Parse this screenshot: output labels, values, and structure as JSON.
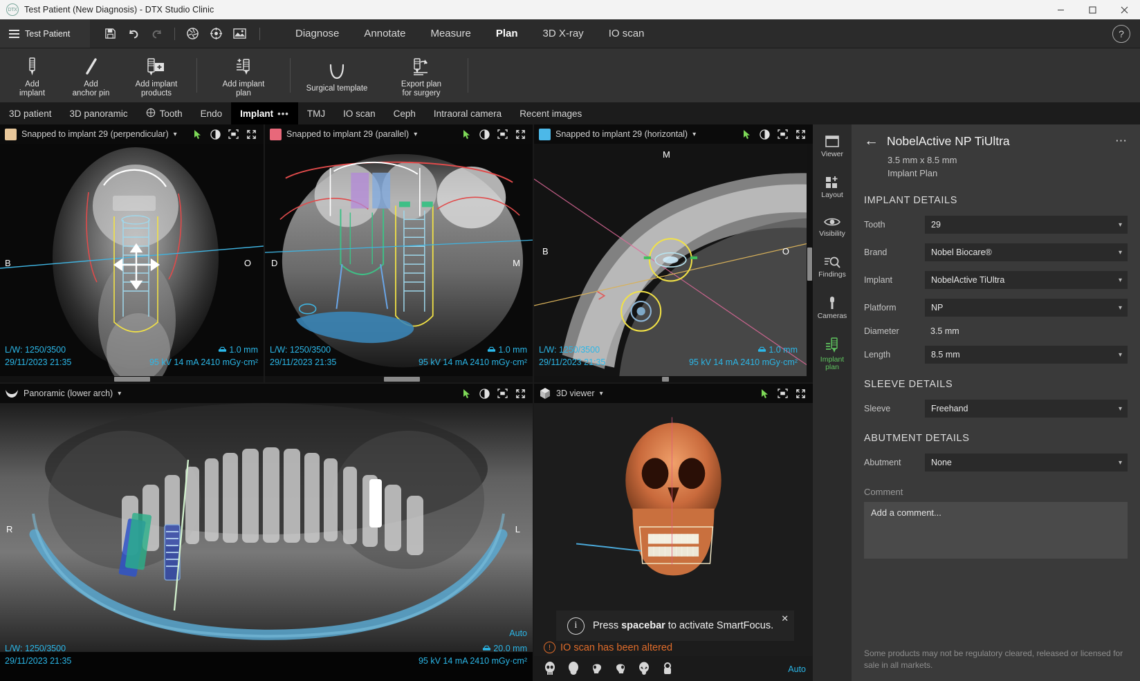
{
  "window": {
    "title": "Test Patient (New Diagnosis) - DTX Studio Clinic",
    "app_badge": "DTX",
    "minimize": "─",
    "maximize": "☐",
    "close": "✕"
  },
  "menubar": {
    "patient_name": "Test Patient",
    "icons": [
      "save-icon",
      "undo-icon",
      "redo-icon",
      "aperture-icon",
      "crosshair-icon",
      "image-icon"
    ],
    "items": [
      {
        "label": "Diagnose",
        "active": false
      },
      {
        "label": "Annotate",
        "active": false
      },
      {
        "label": "Measure",
        "active": false
      },
      {
        "label": "Plan",
        "active": true
      },
      {
        "label": "3D X-ray",
        "active": false
      },
      {
        "label": "IO scan",
        "active": false
      }
    ],
    "help": "?"
  },
  "ribbon": {
    "buttons": [
      {
        "label_line1": "Add",
        "label_line2": "implant",
        "icon": "implant-icon"
      },
      {
        "label_line1": "Add",
        "label_line2": "anchor pin",
        "icon": "anchor-pin-icon"
      },
      {
        "label_line1": "Add implant",
        "label_line2": "products",
        "icon": "implant-products-icon"
      },
      {
        "label_line1": "Add implant",
        "label_line2": "plan",
        "icon": "implant-plan-icon"
      },
      {
        "label_line1": "Surgical template",
        "label_line2": "",
        "icon": "surgical-template-icon"
      },
      {
        "label_line1": "Export plan",
        "label_line2": "for surgery",
        "icon": "export-plan-icon"
      }
    ]
  },
  "tabs": [
    {
      "label": "3D patient",
      "active": false,
      "icon": ""
    },
    {
      "label": "3D panoramic",
      "active": false,
      "icon": ""
    },
    {
      "label": "Tooth",
      "active": false,
      "icon": "tooth-icon"
    },
    {
      "label": "Endo",
      "active": false,
      "icon": ""
    },
    {
      "label": "Implant",
      "active": true,
      "icon": "",
      "overflow": "•••"
    },
    {
      "label": "TMJ",
      "active": false,
      "icon": ""
    },
    {
      "label": "IO scan",
      "active": false,
      "icon": ""
    },
    {
      "label": "Ceph",
      "active": false,
      "icon": ""
    },
    {
      "label": "Intraoral camera",
      "active": false,
      "icon": ""
    },
    {
      "label": "Recent images",
      "active": false,
      "icon": ""
    }
  ],
  "viewports": {
    "perpendicular": {
      "title": "Snapped to implant 29 (perpendicular)",
      "swatch_color": "#e8c79a",
      "lw": "L/W: 1250/3500",
      "datetime": "29/11/2023 21:35",
      "thickness": "1.0 mm",
      "dose": "95 kV  14 mA  2410 mGy·cm²",
      "marker_left": "B",
      "marker_right": "O"
    },
    "parallel": {
      "title": "Snapped to implant 29 (parallel)",
      "swatch_color": "#e8687a",
      "lw": "L/W: 1250/3500",
      "datetime": "29/11/2023 21:35",
      "thickness": "1.0 mm",
      "dose": "95 kV  14 mA  2410 mGy·cm²",
      "marker_left": "D",
      "marker_right": "M"
    },
    "horizontal": {
      "title": "Snapped to implant 29 (horizontal)",
      "swatch_color": "#4cb8e8",
      "lw": "L/W: 1250/3500",
      "datetime": "29/11/2023 21:35",
      "thickness": "1.0 mm",
      "dose": "95 kV  14 mA  2410 mGy·cm²",
      "marker_left": "B",
      "marker_right": "O",
      "marker_top": "M"
    },
    "panoramic": {
      "title": "Panoramic (lower arch)",
      "lw": "L/W: 1250/3500",
      "datetime": "29/11/2023 21:35",
      "thickness": "20.0 mm",
      "dose": "95 kV  14 mA  2410 mGy·cm²",
      "auto": "Auto",
      "marker_left": "R",
      "marker_right": "L"
    },
    "viewer3d": {
      "title": "3D viewer",
      "auto": "Auto",
      "toast": {
        "text_before": "Press ",
        "text_bold": "spacebar",
        "text_after": " to activate SmartFocus.",
        "close": "✕"
      },
      "warning": "IO scan has been altered"
    }
  },
  "rail": [
    {
      "label": "Viewer",
      "icon": "viewer-icon",
      "active": false
    },
    {
      "label": "Layout",
      "icon": "layout-icon",
      "active": false
    },
    {
      "label": "Visibility",
      "icon": "eye-icon",
      "active": false
    },
    {
      "label": "Findings",
      "icon": "findings-icon",
      "active": false
    },
    {
      "label": "Cameras",
      "icon": "camera-icon",
      "active": false
    },
    {
      "label": "Implant\nplan",
      "icon": "implant-plan-icon",
      "active": true
    }
  ],
  "panel": {
    "title": "NobelActive NP TiUltra",
    "subtitle_size": "3.5 mm x 8.5 mm",
    "subtitle_type": "Implant Plan",
    "back": "←",
    "kebab": "⋯",
    "sections": {
      "implant_details": {
        "heading": "IMPLANT DETAILS",
        "fields": [
          {
            "label": "Tooth",
            "value": "29",
            "type": "select"
          },
          {
            "label": "Brand",
            "value": "Nobel Biocare®",
            "type": "select"
          },
          {
            "label": "Implant",
            "value": "NobelActive TiUltra",
            "type": "select"
          },
          {
            "label": "Platform",
            "value": "NP",
            "type": "select"
          },
          {
            "label": "Diameter",
            "value": "3.5 mm",
            "type": "text"
          },
          {
            "label": "Length",
            "value": "8.5 mm",
            "type": "select"
          }
        ]
      },
      "sleeve_details": {
        "heading": "SLEEVE DETAILS",
        "fields": [
          {
            "label": "Sleeve",
            "value": "Freehand",
            "type": "select"
          }
        ]
      },
      "abutment_details": {
        "heading": "ABUTMENT DETAILS",
        "fields": [
          {
            "label": "Abutment",
            "value": "None",
            "type": "select"
          }
        ]
      }
    },
    "comment_label": "Comment",
    "comment_placeholder": "Add a comment...",
    "disclaimer": "Some products may not be regulatory cleared, released or licensed for sale in all markets.",
    "collapse": "›"
  }
}
